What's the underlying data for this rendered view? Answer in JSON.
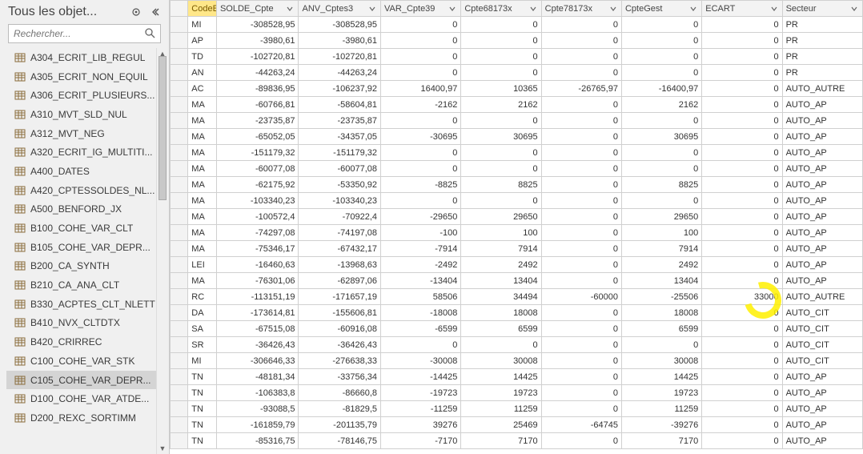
{
  "nav": {
    "title": "Tous les objet...",
    "searchPlaceholder": "Rechercher...",
    "items": [
      {
        "label": "A304_ECRIT_LIB_REGUL"
      },
      {
        "label": "A305_ECRIT_NON_EQUIL"
      },
      {
        "label": "A306_ECRIT_PLUSIEURS..."
      },
      {
        "label": "A310_MVT_SLD_NUL"
      },
      {
        "label": "A312_MVT_NEG"
      },
      {
        "label": "A320_ECRIT_IG_MULTITI..."
      },
      {
        "label": "A400_DATES"
      },
      {
        "label": "A420_CPTESSOLDES_NL..."
      },
      {
        "label": "A500_BENFORD_JX"
      },
      {
        "label": "B100_COHE_VAR_CLT"
      },
      {
        "label": "B105_COHE_VAR_DEPR..."
      },
      {
        "label": "B200_CA_SYNTH"
      },
      {
        "label": "B210_CA_ANA_CLT"
      },
      {
        "label": "B330_ACPTES_CLT_NLETT"
      },
      {
        "label": "B410_NVX_CLTDTX"
      },
      {
        "label": "B420_CRIRREC"
      },
      {
        "label": "C100_COHE_VAR_STK"
      },
      {
        "label": "C105_COHE_VAR_DEPR...",
        "selected": true
      },
      {
        "label": "D100_COHE_VAR_ATDE..."
      },
      {
        "label": "D200_REXC_SORTIMM"
      }
    ]
  },
  "grid": {
    "columns": [
      {
        "key": "code",
        "label": "CodeEntité",
        "highlight": true
      },
      {
        "key": "solde",
        "label": "SOLDE_Cpte"
      },
      {
        "key": "anv",
        "label": "ANV_Cptes3"
      },
      {
        "key": "var",
        "label": "VAR_Cpte39"
      },
      {
        "key": "c68",
        "label": "Cpte68173x"
      },
      {
        "key": "c78",
        "label": "Cpte78173x"
      },
      {
        "key": "gest",
        "label": "CpteGest"
      },
      {
        "key": "ecart",
        "label": "ECART"
      },
      {
        "key": "sect",
        "label": "Secteur"
      }
    ],
    "rows": [
      {
        "code": "MI",
        "solde": "-308528,95",
        "anv": "-308528,95",
        "var": "0",
        "c68": "0",
        "c78": "0",
        "gest": "0",
        "ecart": "0",
        "sect": "PR"
      },
      {
        "code": "AP",
        "solde": "-3980,61",
        "anv": "-3980,61",
        "var": "0",
        "c68": "0",
        "c78": "0",
        "gest": "0",
        "ecart": "0",
        "sect": "PR"
      },
      {
        "code": "TD",
        "solde": "-102720,81",
        "anv": "-102720,81",
        "var": "0",
        "c68": "0",
        "c78": "0",
        "gest": "0",
        "ecart": "0",
        "sect": "PR"
      },
      {
        "code": "AN",
        "solde": "-44263,24",
        "anv": "-44263,24",
        "var": "0",
        "c68": "0",
        "c78": "0",
        "gest": "0",
        "ecart": "0",
        "sect": "PR"
      },
      {
        "code": "AC",
        "solde": "-89836,95",
        "anv": "-106237,92",
        "var": "16400,97",
        "c68": "10365",
        "c78": "-26765,97",
        "gest": "-16400,97",
        "ecart": "0",
        "sect": "AUTO_AUTRE"
      },
      {
        "code": "MA",
        "solde": "-60766,81",
        "anv": "-58604,81",
        "var": "-2162",
        "c68": "2162",
        "c78": "0",
        "gest": "2162",
        "ecart": "0",
        "sect": "AUTO_AP"
      },
      {
        "code": "MA",
        "solde": "-23735,87",
        "anv": "-23735,87",
        "var": "0",
        "c68": "0",
        "c78": "0",
        "gest": "0",
        "ecart": "0",
        "sect": "AUTO_AP"
      },
      {
        "code": "MA",
        "solde": "-65052,05",
        "anv": "-34357,05",
        "var": "-30695",
        "c68": "30695",
        "c78": "0",
        "gest": "30695",
        "ecart": "0",
        "sect": "AUTO_AP"
      },
      {
        "code": "MA",
        "solde": "-151179,32",
        "anv": "-151179,32",
        "var": "0",
        "c68": "0",
        "c78": "0",
        "gest": "0",
        "ecart": "0",
        "sect": "AUTO_AP"
      },
      {
        "code": "MA",
        "solde": "-60077,08",
        "anv": "-60077,08",
        "var": "0",
        "c68": "0",
        "c78": "0",
        "gest": "0",
        "ecart": "0",
        "sect": "AUTO_AP"
      },
      {
        "code": "MA",
        "solde": "-62175,92",
        "anv": "-53350,92",
        "var": "-8825",
        "c68": "8825",
        "c78": "0",
        "gest": "8825",
        "ecart": "0",
        "sect": "AUTO_AP"
      },
      {
        "code": "MA",
        "solde": "-103340,23",
        "anv": "-103340,23",
        "var": "0",
        "c68": "0",
        "c78": "0",
        "gest": "0",
        "ecart": "0",
        "sect": "AUTO_AP"
      },
      {
        "code": "MA",
        "solde": "-100572,4",
        "anv": "-70922,4",
        "var": "-29650",
        "c68": "29650",
        "c78": "0",
        "gest": "29650",
        "ecart": "0",
        "sect": "AUTO_AP"
      },
      {
        "code": "MA",
        "solde": "-74297,08",
        "anv": "-74197,08",
        "var": "-100",
        "c68": "100",
        "c78": "0",
        "gest": "100",
        "ecart": "0",
        "sect": "AUTO_AP"
      },
      {
        "code": "MA",
        "solde": "-75346,17",
        "anv": "-67432,17",
        "var": "-7914",
        "c68": "7914",
        "c78": "0",
        "gest": "7914",
        "ecart": "0",
        "sect": "AUTO_AP"
      },
      {
        "code": "LEI",
        "solde": "-16460,63",
        "anv": "-13968,63",
        "var": "-2492",
        "c68": "2492",
        "c78": "0",
        "gest": "2492",
        "ecart": "0",
        "sect": "AUTO_AP"
      },
      {
        "code": "MA",
        "solde": "-76301,06",
        "anv": "-62897,06",
        "var": "-13404",
        "c68": "13404",
        "c78": "0",
        "gest": "13404",
        "ecart": "0",
        "sect": "AUTO_AP"
      },
      {
        "code": "RC",
        "solde": "-113151,19",
        "anv": "-171657,19",
        "var": "58506",
        "c68": "34494",
        "c78": "-60000",
        "gest": "-25506",
        "ecart": "33000",
        "sect": "AUTO_AUTRE"
      },
      {
        "code": "DA",
        "solde": "-173614,81",
        "anv": "-155606,81",
        "var": "-18008",
        "c68": "18008",
        "c78": "0",
        "gest": "18008",
        "ecart": "0",
        "sect": "AUTO_CIT"
      },
      {
        "code": "SA",
        "solde": "-67515,08",
        "anv": "-60916,08",
        "var": "-6599",
        "c68": "6599",
        "c78": "0",
        "gest": "6599",
        "ecart": "0",
        "sect": "AUTO_CIT"
      },
      {
        "code": "SR",
        "solde": "-36426,43",
        "anv": "-36426,43",
        "var": "0",
        "c68": "0",
        "c78": "0",
        "gest": "0",
        "ecart": "0",
        "sect": "AUTO_CIT"
      },
      {
        "code": "MI",
        "solde": "-306646,33",
        "anv": "-276638,33",
        "var": "-30008",
        "c68": "30008",
        "c78": "0",
        "gest": "30008",
        "ecart": "0",
        "sect": "AUTO_CIT"
      },
      {
        "code": "TN",
        "solde": "-48181,34",
        "anv": "-33756,34",
        "var": "-14425",
        "c68": "14425",
        "c78": "0",
        "gest": "14425",
        "ecart": "0",
        "sect": "AUTO_AP"
      },
      {
        "code": "TN",
        "solde": "-106383,8",
        "anv": "-86660,8",
        "var": "-19723",
        "c68": "19723",
        "c78": "0",
        "gest": "19723",
        "ecart": "0",
        "sect": "AUTO_AP"
      },
      {
        "code": "TN",
        "solde": "-93088,5",
        "anv": "-81829,5",
        "var": "-11259",
        "c68": "11259",
        "c78": "0",
        "gest": "11259",
        "ecart": "0",
        "sect": "AUTO_AP"
      },
      {
        "code": "TN",
        "solde": "-161859,79",
        "anv": "-201135,79",
        "var": "39276",
        "c68": "25469",
        "c78": "-64745",
        "gest": "-39276",
        "ecart": "0",
        "sect": "AUTO_AP"
      },
      {
        "code": "TN",
        "solde": "-85316,75",
        "anv": "-78146,75",
        "var": "-7170",
        "c68": "7170",
        "c78": "0",
        "gest": "7170",
        "ecart": "0",
        "sect": "AUTO_AP"
      }
    ]
  },
  "icons": {
    "pin": "⊙",
    "collapse": "«"
  }
}
